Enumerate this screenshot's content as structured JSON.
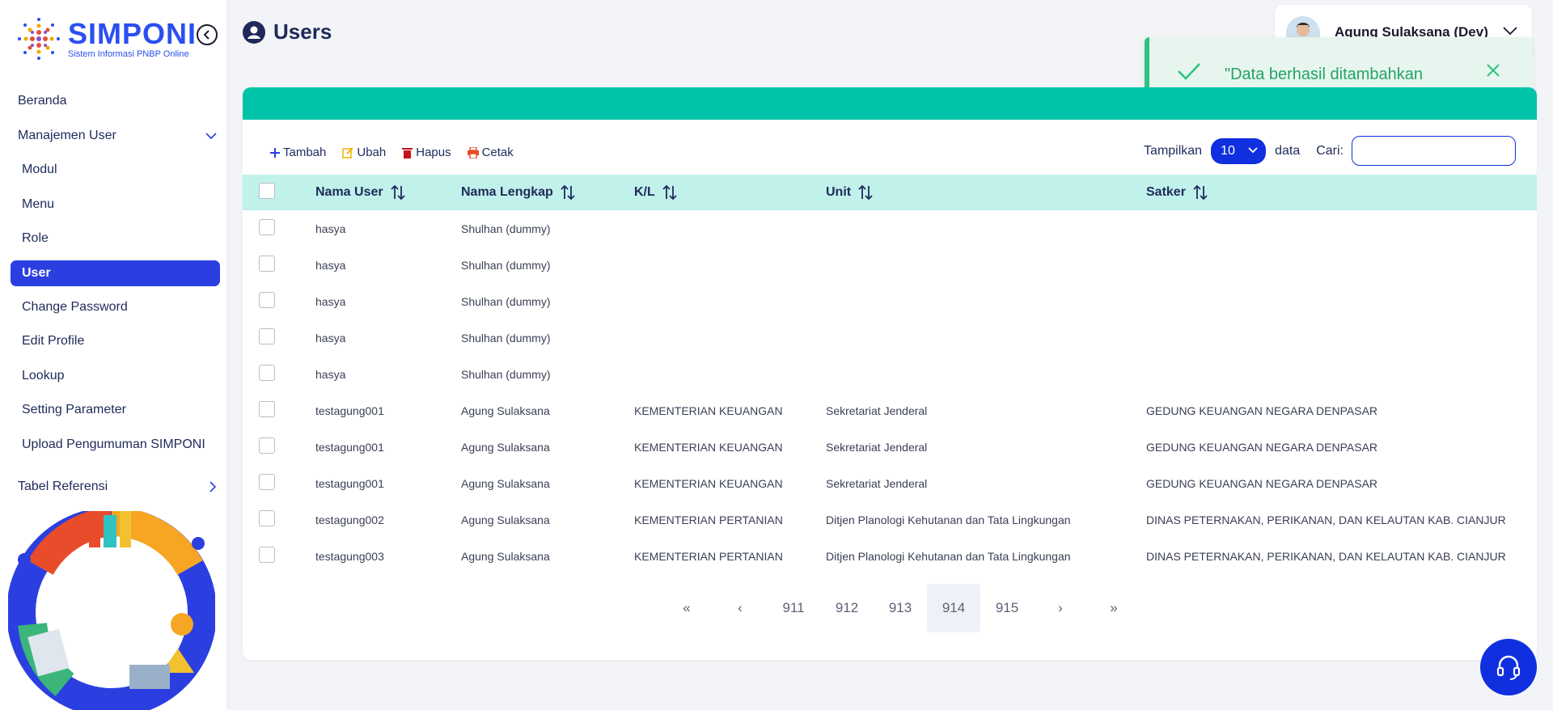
{
  "app": {
    "logo_title": "SIMPONI",
    "logo_subtitle": "Sistem Informasi PNBP Online"
  },
  "sidebar": {
    "items": [
      {
        "label": "Beranda",
        "level": "top"
      },
      {
        "label": "Manajemen User",
        "level": "top",
        "expanded": true
      },
      {
        "label": "Modul",
        "level": "sub"
      },
      {
        "label": "Menu",
        "level": "sub"
      },
      {
        "label": "Role",
        "level": "sub"
      },
      {
        "label": "User",
        "level": "sub",
        "active": true
      },
      {
        "label": "Change Password",
        "level": "sub"
      },
      {
        "label": "Edit Profile",
        "level": "sub"
      },
      {
        "label": "Lookup",
        "level": "sub"
      },
      {
        "label": "Setting Parameter",
        "level": "sub"
      },
      {
        "label": "Upload Pengumuman SIMPONI",
        "level": "sub"
      },
      {
        "label": "Tabel Referensi",
        "level": "top",
        "expanded": false
      }
    ]
  },
  "header": {
    "title": "Users",
    "user_name": "Agung Sulaksana (Dev)"
  },
  "toast": {
    "message": "\"Data berhasil ditambahkan"
  },
  "toolbar": {
    "add_label": "Tambah",
    "edit_label": "Ubah",
    "delete_label": "Hapus",
    "print_label": "Cetak",
    "show_label": "Tampilkan",
    "page_size": "10",
    "data_label": "data",
    "search_label": "Cari:",
    "search_value": ""
  },
  "table": {
    "headers": [
      "Nama User",
      "Nama Lengkap",
      "K/L",
      "Unit",
      "Satker"
    ],
    "rows": [
      [
        "hasya",
        "Shulhan (dummy)",
        "",
        "",
        ""
      ],
      [
        "hasya",
        "Shulhan (dummy)",
        "",
        "",
        ""
      ],
      [
        "hasya",
        "Shulhan (dummy)",
        "",
        "",
        ""
      ],
      [
        "hasya",
        "Shulhan (dummy)",
        "",
        "",
        ""
      ],
      [
        "hasya",
        "Shulhan (dummy)",
        "",
        "",
        ""
      ],
      [
        "testagung001",
        "Agung Sulaksana",
        "KEMENTERIAN KEUANGAN",
        "Sekretariat Jenderal",
        "GEDUNG KEUANGAN NEGARA DENPASAR"
      ],
      [
        "testagung001",
        "Agung Sulaksana",
        "KEMENTERIAN KEUANGAN",
        "Sekretariat Jenderal",
        "GEDUNG KEUANGAN NEGARA DENPASAR"
      ],
      [
        "testagung001",
        "Agung Sulaksana",
        "KEMENTERIAN KEUANGAN",
        "Sekretariat Jenderal",
        "GEDUNG KEUANGAN NEGARA DENPASAR"
      ],
      [
        "testagung002",
        "Agung Sulaksana",
        "KEMENTERIAN PERTANIAN",
        "Ditjen Planologi Kehutanan dan Tata Lingkungan",
        "DINAS PETERNAKAN, PERIKANAN, DAN KELAUTAN KAB. CIANJUR"
      ],
      [
        "testagung003",
        "Agung Sulaksana",
        "KEMENTERIAN PERTANIAN",
        "Ditjen Planologi Kehutanan dan Tata Lingkungan",
        "DINAS PETERNAKAN, PERIKANAN, DAN KELAUTAN KAB. CIANJUR"
      ]
    ]
  },
  "pagination": {
    "first": "«",
    "prev": "‹",
    "pages": [
      "911",
      "912",
      "913",
      "914",
      "915"
    ],
    "current": "914",
    "next": "›",
    "last": "»"
  },
  "colors": {
    "brand": "#2b4ff0",
    "accent_teal": "#00c3a8",
    "header_row": "#c1f1eb",
    "active_nav": "#2b3fe0",
    "success": "#26a267"
  },
  "icons": {
    "collapse": "chevron-left-circle-icon",
    "page_title": "user-circle-icon",
    "toast": "check-icon",
    "help": "headset-icon"
  }
}
